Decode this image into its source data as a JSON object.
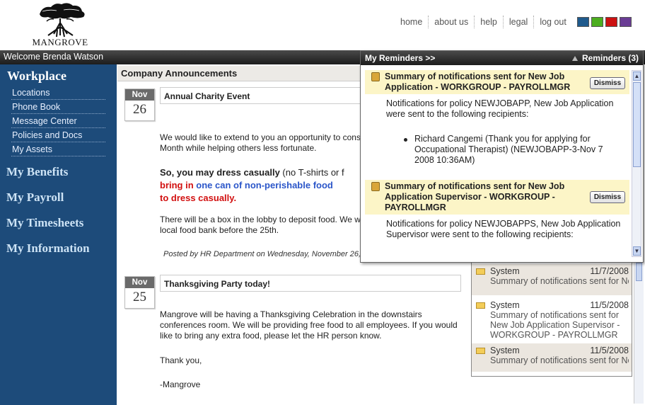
{
  "brand": {
    "name": "MANGROVE"
  },
  "topnav": [
    {
      "label": "home"
    },
    {
      "label": "about us"
    },
    {
      "label": "help"
    },
    {
      "label": "legal"
    },
    {
      "label": "log out"
    }
  ],
  "swatches": [
    "#1f5a8c",
    "#4cae1f",
    "#cc1111",
    "#6a3c94"
  ],
  "welcome": "Welcome Brenda Watson",
  "sidebar": {
    "workplace": "Workplace",
    "sub_items": [
      {
        "label": "Locations"
      },
      {
        "label": "Phone Book"
      },
      {
        "label": "Message Center"
      },
      {
        "label": "Policies and Docs"
      },
      {
        "label": "My Assets"
      }
    ],
    "sections": [
      {
        "label": "My Benefits"
      },
      {
        "label": "My Payroll"
      },
      {
        "label": "My Timesheets"
      },
      {
        "label": "My Information"
      }
    ]
  },
  "announcements": {
    "heading": "Company Announcements",
    "items": [
      {
        "month": "Nov",
        "day": "26",
        "title": "Annual Charity Event",
        "intro_1": "We would like to extend to you an opportunity to cons",
        "intro_2": "Month while helping others less fortunate.",
        "dress_a": "So, you may dress casually",
        "dress_b": " (no T-shirts or f",
        "bring_a": "bring in ",
        "bring_b": "one can of non-perishable food",
        "bring_c": "to dress casually.",
        "box_1": "There will be a box in the lobby to deposit food. We w",
        "box_2": "local food bank before the 25th.",
        "posted": "Posted by HR Department on Wednesday, November 26,"
      },
      {
        "month": "Nov",
        "day": "25",
        "title": "Thanksgiving Party today!",
        "body_1": "Mangrove will be having a Thanksgiving Celebration in the downstairs",
        "body_2": "conferences room. We will be providing free food to all employees. If you would",
        "body_3": "like to bring any extra food, please let the HR person know.",
        "thanks": "Thank you,",
        "sign": "-Mangrove"
      }
    ]
  },
  "messages": [
    {
      "from": "System",
      "date": "11/7/2008",
      "lines": [
        "Summary of notifications sent for Nev"
      ]
    },
    {
      "from": "System",
      "date": "11/5/2008",
      "lines": [
        "Summary of notifications sent for",
        "New Job Application Supervisor -",
        "WORKGROUP - PAYROLLMGR"
      ]
    },
    {
      "from": "System",
      "date": "11/5/2008",
      "lines": [
        "Summary of notifications sent for Nev"
      ]
    }
  ],
  "reminders": {
    "title": "My Reminders >>",
    "count_label": "Reminders (3)",
    "dismiss_label": "Dismiss",
    "items": [
      {
        "title": "Summary of notifications sent for New Job Application - WORKGROUP - PAYROLLMGR",
        "text": "Notifications for policy NEWJOBAPP, New Job Application were sent to the following recipients:",
        "recipient": "Richard Cangemi (Thank you for applying for Occupational Therapist) (NEWJOBAPP-3-Nov 7 2008 10:36AM)"
      },
      {
        "title": "Summary of notifications sent for New Job Application Supervisor - WORKGROUP - PAYROLLMGR",
        "text": "Notifications for policy NEWJOBAPPS, New Job Application Supervisor were sent to the following recipients:"
      }
    ]
  }
}
